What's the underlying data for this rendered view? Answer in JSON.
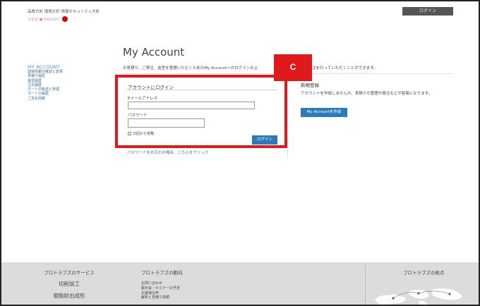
{
  "header": {
    "top_links": "品質方針 環境方針 情報セキュリティ方針",
    "lang_text": "日本語 ■ ENGLISH",
    "login_button": "ログイン"
  },
  "sidebar": {
    "title": "MY ACCOUNT",
    "items": [
      "登録情報の確認と変更",
      "見積り履歴",
      "金型履歴",
      "注文履歴",
      "カートの転送と管理",
      "カートの履歴",
      "ご支払情報"
    ]
  },
  "main": {
    "title": "My Account",
    "intro": "お見積り、ご発注、金型を管理いただくためのMy Accountへのログインおよ",
    "intro_tail": "注を行っていただくことができます。"
  },
  "login": {
    "heading": "アカウントにログイン",
    "email_label": "Eメールアドレス",
    "email_value": "",
    "password_label": "パスワード",
    "password_value": "",
    "remember_label": "次回から省略",
    "submit_label": "ログイン",
    "forgot_link": "パスワードをお忘れの場合、こちらをクリック"
  },
  "annotation": {
    "badge": "C",
    "color": "#e01a1a"
  },
  "new_registration": {
    "title": "新規登録",
    "text": "アカウントを作成しませんか。見積りの管理や発注などが容易になります。",
    "button": "My Accountを作成"
  },
  "footer": {
    "services_title": "プロトラブズのサービス",
    "services": [
      "切削加工",
      "樹脂射出成形"
    ],
    "news_title": "プロトラブズの動向",
    "news_links": [
      "お問い合わせ",
      "展示会・セミナーの予定",
      "お客様の声",
      "解析と見積り依頼"
    ],
    "locations_title": "プロトラブズの拠点"
  },
  "colors": {
    "accent_blue": "#2b7bb9",
    "link_blue": "#3d6a99",
    "highlight_red": "#e01a1a",
    "footer_gray": "#dcdcdc"
  }
}
